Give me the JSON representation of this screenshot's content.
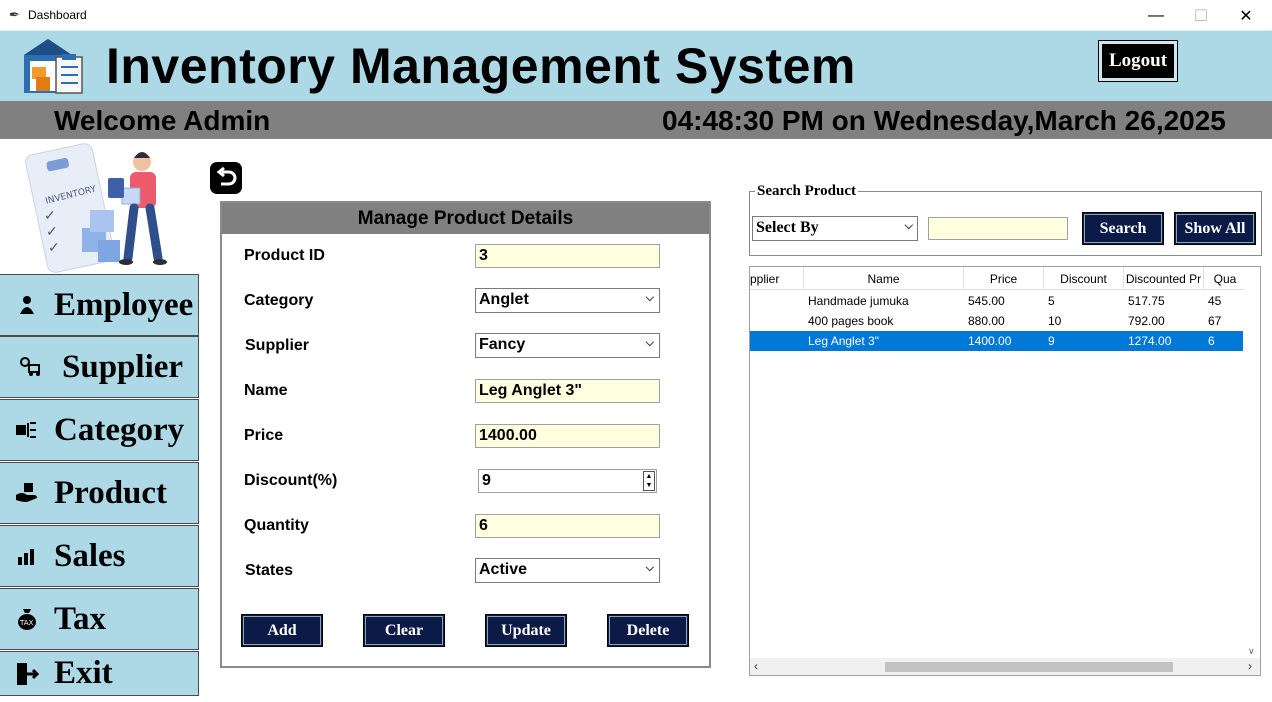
{
  "window": {
    "title": "Dashboard"
  },
  "header": {
    "title": "Inventory Management System",
    "logout_label": "Logout"
  },
  "status": {
    "welcome": "Welcome Admin",
    "datetime": "04:48:30 PM on Wednesday,March 26,2025"
  },
  "sidebar": {
    "items": [
      {
        "label": "Employee",
        "icon": "employee-icon"
      },
      {
        "label": "Supplier",
        "icon": "supplier-icon"
      },
      {
        "label": "Category",
        "icon": "category-icon"
      },
      {
        "label": "Product",
        "icon": "product-icon"
      },
      {
        "label": "Sales",
        "icon": "sales-icon"
      },
      {
        "label": "Tax",
        "icon": "tax-icon"
      },
      {
        "label": "Exit",
        "icon": "exit-icon"
      }
    ]
  },
  "illustration": {
    "inventory_text": "INVENTORY"
  },
  "manage": {
    "title": "Manage Product Details",
    "fields": {
      "product_id": {
        "label": "Product ID",
        "value": "3"
      },
      "category": {
        "label": "Category",
        "value": "Anglet"
      },
      "supplier": {
        "label": "Supplier",
        "value": "Fancy"
      },
      "name": {
        "label": "Name",
        "value": "Leg Anglet 3\""
      },
      "price": {
        "label": "Price",
        "value": "1400.00"
      },
      "discount": {
        "label": "Discount(%)",
        "value": "9"
      },
      "quantity": {
        "label": "Quantity",
        "value": "6"
      },
      "status": {
        "label": "States",
        "value": "Active"
      }
    },
    "buttons": {
      "add": "Add",
      "clear": "Clear",
      "update": "Update",
      "delete": "Delete"
    }
  },
  "search": {
    "legend": "Search Product",
    "select_by": "Select By",
    "query": "",
    "search_label": "Search",
    "show_all_label": "Show All"
  },
  "table": {
    "columns": [
      "pplier",
      "Name",
      "Price",
      "Discount",
      "Discounted Pr",
      "Qua"
    ],
    "rows": [
      {
        "supplier": "",
        "name": "Handmade jumuka",
        "price": "545.00",
        "discount": "5",
        "discounted": "517.75",
        "qty": "45"
      },
      {
        "supplier": "",
        "name": "400 pages book",
        "price": "880.00",
        "discount": "10",
        "discounted": "792.00",
        "qty": "67"
      },
      {
        "supplier": "",
        "name": "Leg Anglet 3\"",
        "price": "1400.00",
        "discount": "9",
        "discounted": "1274.00",
        "qty": "6"
      }
    ],
    "selected_index": 2
  },
  "colors": {
    "header_bg": "#add8e6",
    "bar_bg": "#808080",
    "button_bg": "#0b1a46",
    "input_bg": "#ffffe0",
    "selection": "#0078d7"
  }
}
